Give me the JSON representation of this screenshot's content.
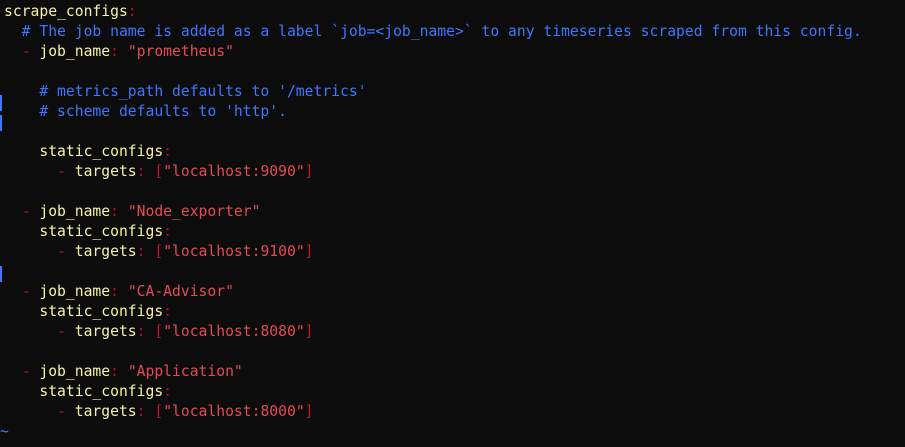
{
  "colors": {
    "background": "#0c0c0c",
    "key": "#f9f1a5",
    "punct": "#c50f1f",
    "string": "#e74856",
    "comment": "#3b78ff",
    "tilde": "#3b78ff"
  },
  "editor": {
    "lines": [
      [
        {
          "t": "scrape_configs",
          "c": "key"
        },
        {
          "t": ":",
          "c": "punct"
        }
      ],
      [
        {
          "t": "  # The job name is added as a label `job=<job_name>` to any timeseries scraped from this config.",
          "c": "comment"
        }
      ],
      [
        {
          "t": "  ",
          "c": "key"
        },
        {
          "t": "-",
          "c": "punct"
        },
        {
          "t": " job_name",
          "c": "key"
        },
        {
          "t": ":",
          "c": "punct"
        },
        {
          "t": " ",
          "c": "key"
        },
        {
          "t": "\"prometheus\"",
          "c": "string"
        }
      ],
      [],
      [
        {
          "t": "    # metrics_path defaults to '/metrics'",
          "c": "comment"
        }
      ],
      [
        {
          "t": "    # scheme defaults to 'http'.",
          "c": "comment"
        }
      ],
      [],
      [
        {
          "t": "    static_configs",
          "c": "key"
        },
        {
          "t": ":",
          "c": "punct"
        }
      ],
      [
        {
          "t": "      ",
          "c": "key"
        },
        {
          "t": "-",
          "c": "punct"
        },
        {
          "t": " targets",
          "c": "key"
        },
        {
          "t": ":",
          "c": "punct"
        },
        {
          "t": " ",
          "c": "key"
        },
        {
          "t": "[",
          "c": "punct"
        },
        {
          "t": "\"localhost:9090\"",
          "c": "string"
        },
        {
          "t": "]",
          "c": "punct"
        }
      ],
      [],
      [
        {
          "t": "  ",
          "c": "key"
        },
        {
          "t": "-",
          "c": "punct"
        },
        {
          "t": " job_name",
          "c": "key"
        },
        {
          "t": ":",
          "c": "punct"
        },
        {
          "t": " ",
          "c": "key"
        },
        {
          "t": "\"Node_exporter\"",
          "c": "string"
        }
      ],
      [
        {
          "t": "    static_configs",
          "c": "key"
        },
        {
          "t": ":",
          "c": "punct"
        }
      ],
      [
        {
          "t": "      ",
          "c": "key"
        },
        {
          "t": "-",
          "c": "punct"
        },
        {
          "t": " targets",
          "c": "key"
        },
        {
          "t": ":",
          "c": "punct"
        },
        {
          "t": " ",
          "c": "key"
        },
        {
          "t": "[",
          "c": "punct"
        },
        {
          "t": "\"localhost:9100\"",
          "c": "string"
        },
        {
          "t": "]",
          "c": "punct"
        }
      ],
      [],
      [
        {
          "t": "  ",
          "c": "key"
        },
        {
          "t": "-",
          "c": "punct"
        },
        {
          "t": " job_name",
          "c": "key"
        },
        {
          "t": ":",
          "c": "punct"
        },
        {
          "t": " ",
          "c": "key"
        },
        {
          "t": "\"CA-Advisor\"",
          "c": "string"
        }
      ],
      [
        {
          "t": "    static_configs",
          "c": "key"
        },
        {
          "t": ":",
          "c": "punct"
        }
      ],
      [
        {
          "t": "      ",
          "c": "key"
        },
        {
          "t": "-",
          "c": "punct"
        },
        {
          "t": " targets",
          "c": "key"
        },
        {
          "t": ":",
          "c": "punct"
        },
        {
          "t": " ",
          "c": "key"
        },
        {
          "t": "[",
          "c": "punct"
        },
        {
          "t": "\"localhost:8080\"",
          "c": "string"
        },
        {
          "t": "]",
          "c": "punct"
        }
      ],
      [],
      [
        {
          "t": "  ",
          "c": "key"
        },
        {
          "t": "-",
          "c": "punct"
        },
        {
          "t": " job_name",
          "c": "key"
        },
        {
          "t": ":",
          "c": "punct"
        },
        {
          "t": " ",
          "c": "key"
        },
        {
          "t": "\"Application\"",
          "c": "string"
        }
      ],
      [
        {
          "t": "    static_configs",
          "c": "key"
        },
        {
          "t": ":",
          "c": "punct"
        }
      ],
      [
        {
          "t": "      ",
          "c": "key"
        },
        {
          "t": "-",
          "c": "punct"
        },
        {
          "t": " targets",
          "c": "key"
        },
        {
          "t": ":",
          "c": "punct"
        },
        {
          "t": " ",
          "c": "key"
        },
        {
          "t": "[",
          "c": "punct"
        },
        {
          "t": "\"localhost:8000\"",
          "c": "string"
        },
        {
          "t": "]",
          "c": "punct"
        }
      ]
    ],
    "empty_line_marker": "~"
  }
}
